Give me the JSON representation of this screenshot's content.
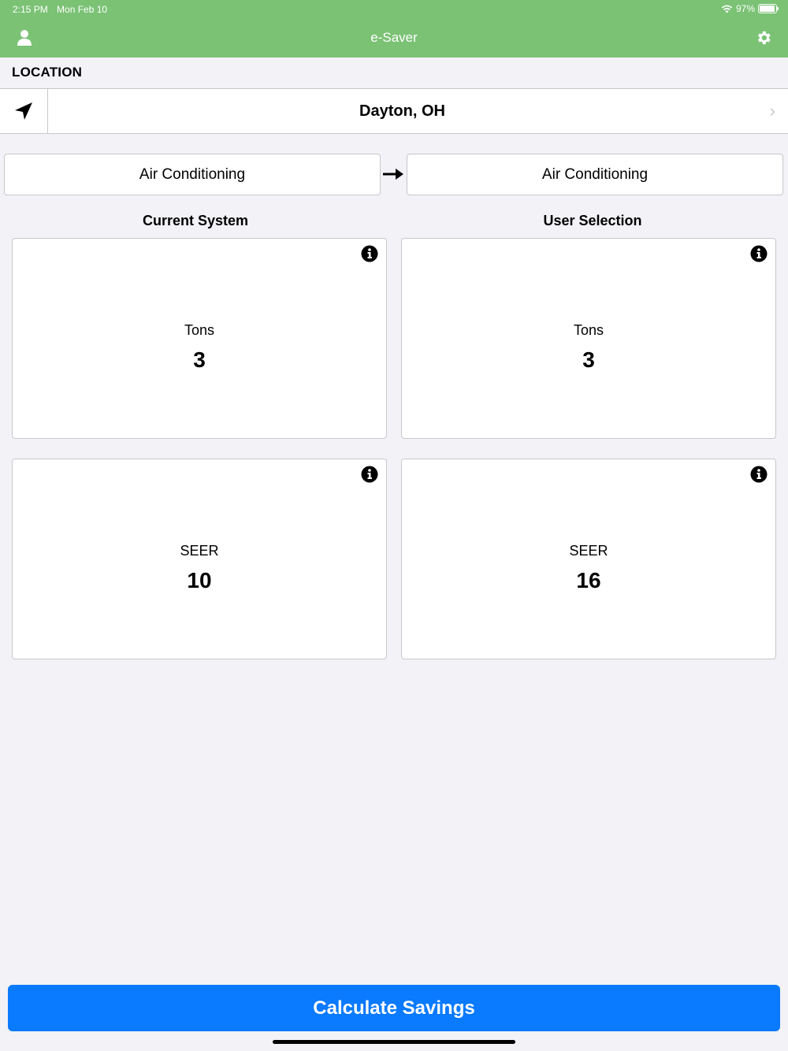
{
  "status_bar": {
    "time": "2:15 PM",
    "date": "Mon Feb 10",
    "battery": "97%",
    "battery_level": 0.97
  },
  "nav": {
    "title": "e-Saver",
    "left_icon": "user-icon",
    "right_icon": "gear-icon",
    "bar_color": "#7bc275"
  },
  "location": {
    "section_label": "LOCATION",
    "city": "Dayton, OH",
    "icon": "location-arrow-icon"
  },
  "systems": {
    "current_type": "Air Conditioning",
    "new_type": "Air Conditioning",
    "current_title": "Current System",
    "user_title": "User Selection"
  },
  "cards": {
    "current_tons": {
      "label": "Tons",
      "value": "3"
    },
    "user_tons": {
      "label": "Tons",
      "value": "3"
    },
    "current_seer": {
      "label": "SEER",
      "value": "10"
    },
    "user_seer": {
      "label": "SEER",
      "value": "16"
    }
  },
  "actions": {
    "calculate_label": "Calculate Savings",
    "accent": "#0a7aff"
  }
}
